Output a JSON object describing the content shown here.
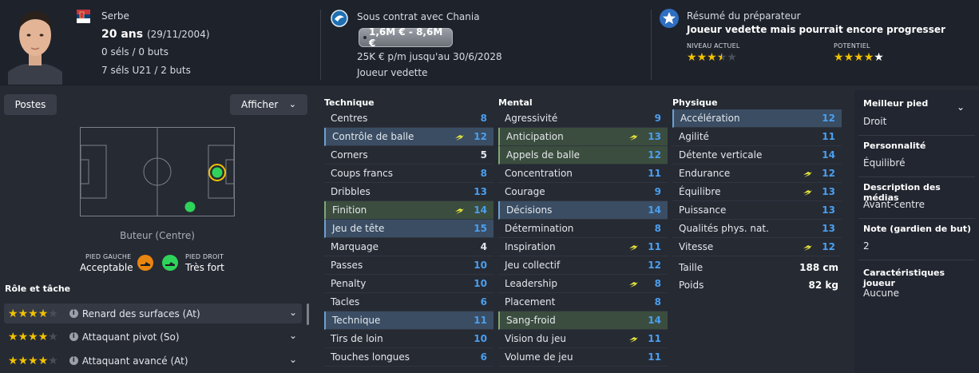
{
  "player": {
    "nationality": "Serbe",
    "age": "20 ans",
    "birth": "(29/11/2004)",
    "caps": "0 séls / 0 buts",
    "u21": "7 séls U21 / 2 buts"
  },
  "contract": {
    "status": "Sous contrat avec Chania",
    "value": "1,6M € - 8,6M €",
    "wage": "25K € p/m jusqu'au 30/6/2028",
    "role": "Joueur vedette"
  },
  "scout": {
    "title": "Résumé du préparateur",
    "summary": "Joueur vedette mais pourrait encore progresser",
    "current_label": "NIVEAU ACTUEL",
    "potential_label": "POTENTIEL",
    "current_stars": 3.5,
    "potential_stars": 4.5
  },
  "left": {
    "positions_btn": "Postes",
    "display_btn": "Afficher",
    "position": "Buteur (Centre)",
    "left_foot_label": "PIED GAUCHE",
    "left_foot": "Acceptable",
    "right_foot_label": "PIED DROIT",
    "right_foot": "Très fort",
    "roles_title": "Rôle et tâche"
  },
  "roles": [
    {
      "name": "Renard des surfaces (At)",
      "stars": 4
    },
    {
      "name": "Attaquant pivot (So)",
      "stars": 4
    },
    {
      "name": "Attaquant avancé (At)",
      "stars": 4
    }
  ],
  "technique": {
    "title": "Technique",
    "rows": [
      {
        "name": "Centres",
        "value": "8",
        "hl": "",
        "arrow": false
      },
      {
        "name": "Contrôle de balle",
        "value": "12",
        "hl": "blue",
        "arrow": true
      },
      {
        "name": "Corners",
        "value": "5",
        "hl": "",
        "arrow": false
      },
      {
        "name": "Coups francs",
        "value": "8",
        "hl": "",
        "arrow": false
      },
      {
        "name": "Dribbles",
        "value": "13",
        "hl": "",
        "arrow": false
      },
      {
        "name": "Finition",
        "value": "14",
        "hl": "green",
        "arrow": true
      },
      {
        "name": "Jeu de tête",
        "value": "15",
        "hl": "blue",
        "arrow": false
      },
      {
        "name": "Marquage",
        "value": "4",
        "hl": "",
        "arrow": false
      },
      {
        "name": "Passes",
        "value": "10",
        "hl": "",
        "arrow": false
      },
      {
        "name": "Penalty",
        "value": "10",
        "hl": "",
        "arrow": false
      },
      {
        "name": "Tacles",
        "value": "6",
        "hl": "",
        "arrow": false
      },
      {
        "name": "Technique",
        "value": "11",
        "hl": "blue",
        "arrow": false
      },
      {
        "name": "Tirs de loin",
        "value": "10",
        "hl": "",
        "arrow": false
      },
      {
        "name": "Touches longues",
        "value": "6",
        "hl": "",
        "arrow": false
      }
    ]
  },
  "mental": {
    "title": "Mental",
    "rows": [
      {
        "name": "Agressivité",
        "value": "9",
        "hl": "",
        "arrow": false
      },
      {
        "name": "Anticipation",
        "value": "13",
        "hl": "green",
        "arrow": true
      },
      {
        "name": "Appels de balle",
        "value": "12",
        "hl": "green",
        "arrow": false
      },
      {
        "name": "Concentration",
        "value": "11",
        "hl": "",
        "arrow": false
      },
      {
        "name": "Courage",
        "value": "9",
        "hl": "",
        "arrow": false
      },
      {
        "name": "Décisions",
        "value": "14",
        "hl": "blue",
        "arrow": false
      },
      {
        "name": "Détermination",
        "value": "8",
        "hl": "",
        "arrow": false
      },
      {
        "name": "Inspiration",
        "value": "11",
        "hl": "",
        "arrow": true
      },
      {
        "name": "Jeu collectif",
        "value": "12",
        "hl": "",
        "arrow": false
      },
      {
        "name": "Leadership",
        "value": "8",
        "hl": "",
        "arrow": true
      },
      {
        "name": "Placement",
        "value": "8",
        "hl": "",
        "arrow": false
      },
      {
        "name": "Sang-froid",
        "value": "14",
        "hl": "green",
        "arrow": false
      },
      {
        "name": "Vision du jeu",
        "value": "11",
        "hl": "",
        "arrow": true
      },
      {
        "name": "Volume de jeu",
        "value": "11",
        "hl": "",
        "arrow": false
      }
    ]
  },
  "physique": {
    "title": "Physique",
    "rows": [
      {
        "name": "Accélération",
        "value": "12",
        "hl": "blue",
        "arrow": false
      },
      {
        "name": "Agilité",
        "value": "11",
        "hl": "",
        "arrow": false
      },
      {
        "name": "Détente verticale",
        "value": "14",
        "hl": "",
        "arrow": false
      },
      {
        "name": "Endurance",
        "value": "12",
        "hl": "",
        "arrow": true
      },
      {
        "name": "Équilibre",
        "value": "13",
        "hl": "",
        "arrow": true
      },
      {
        "name": "Puissance",
        "value": "13",
        "hl": "",
        "arrow": false
      },
      {
        "name": "Qualités phys. nat.",
        "value": "13",
        "hl": "",
        "arrow": false
      },
      {
        "name": "Vitesse",
        "value": "12",
        "hl": "",
        "arrow": true
      }
    ],
    "height_label": "Taille",
    "height": "188 cm",
    "weight_label": "Poids",
    "weight": "82 kg"
  },
  "info": {
    "foot_title": "Meilleur pied",
    "foot": "Droit",
    "pers_title": "Personnalité",
    "pers": "Équilibré",
    "media_title": "Description des médias",
    "media": "Avant-centre",
    "note_title": "Note (gardien de but)",
    "note": "2",
    "traits_title": "Caractéristiques joueur",
    "traits": "Aucune"
  }
}
